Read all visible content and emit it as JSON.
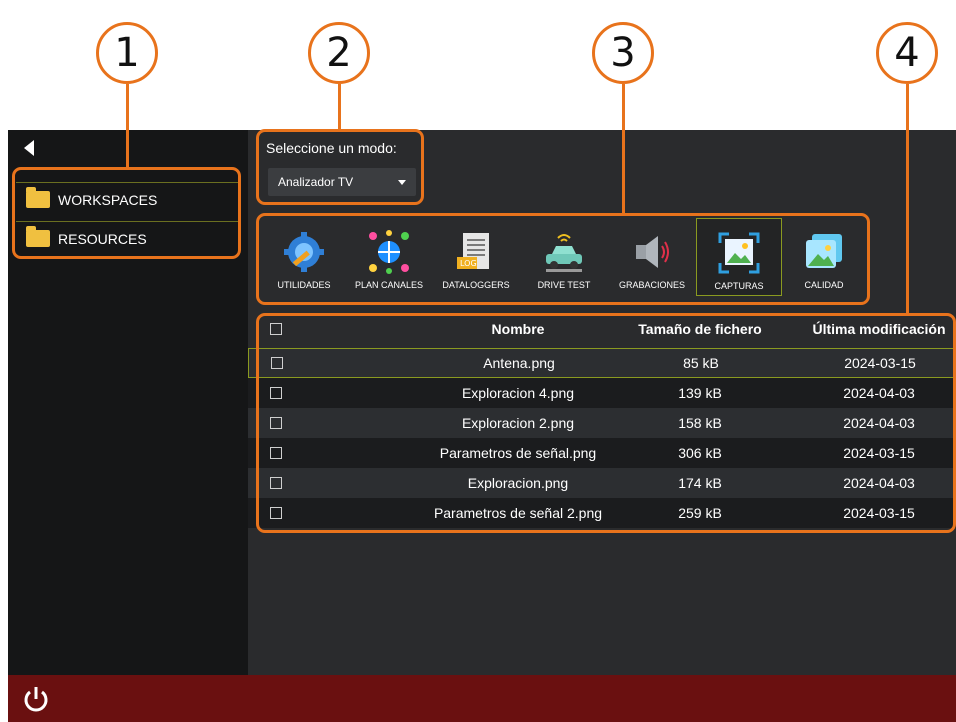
{
  "callouts": [
    "1",
    "2",
    "3",
    "4"
  ],
  "sidebar": {
    "back_icon": "caret-left-icon",
    "items": [
      {
        "label": "WORKSPACES",
        "icon": "folder-icon"
      },
      {
        "label": "RESOURCES",
        "icon": "folder-icon"
      }
    ]
  },
  "mode": {
    "label": "Seleccione un modo:",
    "selected": "Analizador TV"
  },
  "tools": [
    {
      "label": "UTILIDADES",
      "icon": "gear-wrench-icon"
    },
    {
      "label": "PLAN CANALES",
      "icon": "channel-plan-icon"
    },
    {
      "label": "DATALOGGERS",
      "icon": "log-document-icon"
    },
    {
      "label": "DRIVE TEST",
      "icon": "car-signal-icon"
    },
    {
      "label": "GRABACIONES",
      "icon": "speaker-icon"
    },
    {
      "label": "CAPTURAS",
      "icon": "screenshot-icon",
      "active": true
    },
    {
      "label": "CALIDAD",
      "icon": "image-quality-icon"
    }
  ],
  "table": {
    "headers": {
      "name": "Nombre",
      "size": "Tamaño de fichero",
      "date": "Última modificación"
    },
    "rows": [
      {
        "name": "Antena.png",
        "size": "85 kB",
        "date": "2024-03-15"
      },
      {
        "name": "Exploracion 4.png",
        "size": "139 kB",
        "date": "2024-04-03"
      },
      {
        "name": "Exploracion 2.png",
        "size": "158 kB",
        "date": "2024-04-03"
      },
      {
        "name": "Parametros de señal.png",
        "size": "306 kB",
        "date": "2024-03-15"
      },
      {
        "name": "Exploracion.png",
        "size": "174 kB",
        "date": "2024-04-03"
      },
      {
        "name": "Parametros de señal 2.png",
        "size": "259 kB",
        "date": "2024-03-15"
      }
    ]
  },
  "bottombar": {
    "power_icon": "power-icon"
  },
  "colors": {
    "accent": "#e8731c",
    "bottombar": "#6a1010",
    "selection": "#8a9a20"
  }
}
